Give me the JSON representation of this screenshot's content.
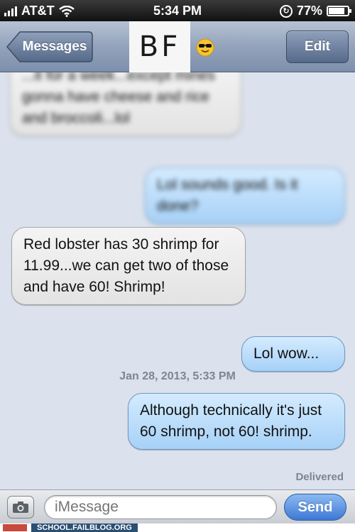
{
  "status_bar": {
    "carrier": "AT&T",
    "time": "5:34 PM",
    "battery": "77%",
    "battery_level": 0.77
  },
  "nav": {
    "back_label": "Messages",
    "title": "BF",
    "title_icon": "sunglasses-emoji-icon",
    "edit_label": "Edit"
  },
  "messages": [
    {
      "direction": "incoming",
      "text": "...it for a week...except mines gonna have cheese and rice and broccoli...lol",
      "blurred": true
    },
    {
      "direction": "outgoing",
      "text": "Lol sounds good. Is it done?",
      "blurred": true
    },
    {
      "direction": "incoming",
      "text": "Red lobster has 30 shrimp for 11.99...we can get two of those and have 60! Shrimp!",
      "blurred": false
    },
    {
      "direction": "outgoing",
      "text": "Lol wow...",
      "blurred": false
    },
    {
      "direction": "outgoing",
      "text": "Although technically it's just 60 shrimp, not 60! shrimp.",
      "blurred": false
    }
  ],
  "timestamp": "Jan 28, 2013, 5:33 PM",
  "delivered": "Delivered",
  "input": {
    "placeholder": "iMessage",
    "send_label": "Send"
  },
  "watermark": "SCHOOL.FAILBLOG.ORG",
  "colors": {
    "incoming_bubble": "#ececec",
    "outgoing_bubble": "#bcdcfb",
    "send_button": "#3d78d4",
    "nav_bar": "#93a3bb"
  }
}
